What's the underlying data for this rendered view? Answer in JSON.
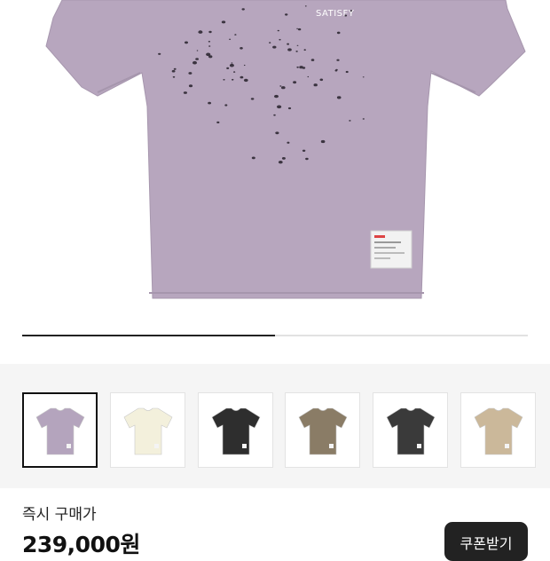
{
  "product": {
    "brand_print": "SATISFY",
    "main_color": "#b7a6be"
  },
  "gallery": {
    "progress": 0.5,
    "thumbnails": [
      {
        "name": "lavender-distressed-tee",
        "color": "#b4a4bd",
        "selected": true
      },
      {
        "name": "cream-graphic-tee",
        "color": "#f3f0dc",
        "selected": false
      },
      {
        "name": "black-tee",
        "color": "#2e2e2e",
        "selected": false
      },
      {
        "name": "olive-photo-tee",
        "color": "#8a7c66",
        "selected": false
      },
      {
        "name": "charcoal-tee",
        "color": "#3a3a3a",
        "selected": false
      },
      {
        "name": "tan-graphic-tee",
        "color": "#cbb89a",
        "selected": false
      }
    ]
  },
  "price": {
    "label": "즉시 구매가",
    "value": "239,000원"
  },
  "coupon_button": {
    "label": "쿠폰받기"
  }
}
